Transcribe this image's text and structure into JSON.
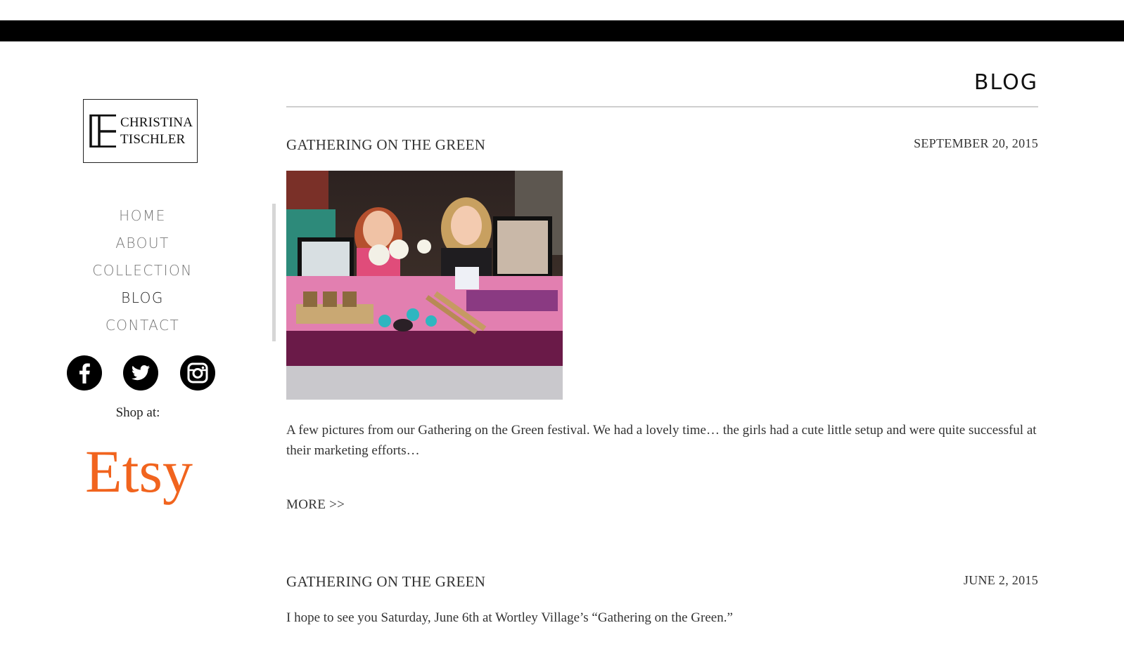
{
  "logo": {
    "line1": "CHRISTINA",
    "line2": "TISCHLER"
  },
  "nav": {
    "items": [
      {
        "label": "HOME"
      },
      {
        "label": "ABOUT"
      },
      {
        "label": "COLLECTION"
      },
      {
        "label": "BLOG",
        "active": true
      },
      {
        "label": "CONTACT"
      }
    ]
  },
  "socials": [
    {
      "icon": "facebook-icon"
    },
    {
      "icon": "twitter-icon"
    },
    {
      "icon": "instagram-icon"
    }
  ],
  "shop": {
    "label": "Shop at:",
    "store": "Etsy",
    "store_color": "#f1641e"
  },
  "page": {
    "heading": "BLOG"
  },
  "posts": [
    {
      "title": "GATHERING ON THE GREEN",
      "date": "SEPTEMBER 20, 2015",
      "excerpt": "A few pictures from our Gathering on the Green festival. We had a lovely time… the girls had a cute little setup and were quite successful at their marketing efforts…",
      "more_label": "MORE >>"
    },
    {
      "title": "GATHERING ON THE GREEN",
      "date": "JUNE 2, 2015",
      "excerpt": "I hope to see you Saturday, June 6th at Wortley Village’s “Gathering on the Green.”"
    }
  ]
}
